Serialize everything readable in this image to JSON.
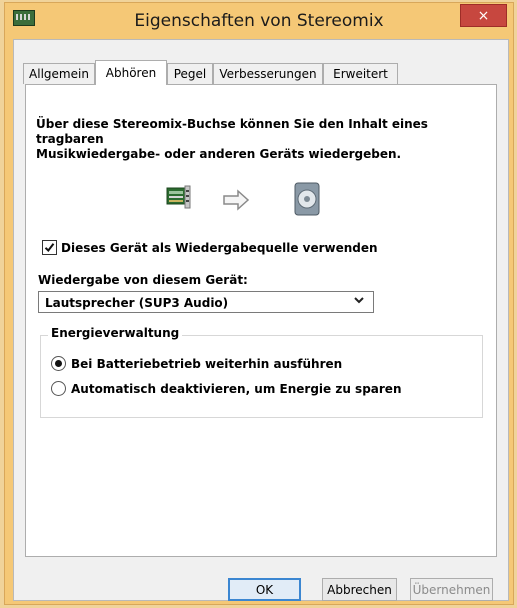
{
  "window": {
    "title": "Eigenschaften von Stereomix",
    "close_glyph": "×"
  },
  "tabs": [
    "Allgemein",
    "Abhören",
    "Pegel",
    "Verbesserungen",
    "Erweitert"
  ],
  "active_tab": "Abhören",
  "content": {
    "description_line1": "Über diese Stereomix-Buchse können Sie den Inhalt eines tragbaren",
    "description_line2": "Musikwiedergabe- oder anderen Geräts wiedergeben.",
    "checkbox_label": "Dieses Gerät als Wiedergabequelle verwenden",
    "checkbox_checked": true,
    "select_label": "Wiedergabe von diesem Gerät:",
    "select_value": "Lautsprecher (SUP3 Audio)",
    "group_title": "Energieverwaltung",
    "radio_1": "Bei Batteriebetrieb weiterhin ausführen",
    "radio_2": "Automatisch deaktivieren, um Energie zu sparen",
    "radio_selected": 1
  },
  "buttons": {
    "ok": "OK",
    "cancel": "Abbrechen",
    "apply": "Übernehmen"
  },
  "icons": [
    "sound-card-icon",
    "arrow-right-icon",
    "speaker-icon",
    "checkmark-icon",
    "chevron-down-icon"
  ]
}
